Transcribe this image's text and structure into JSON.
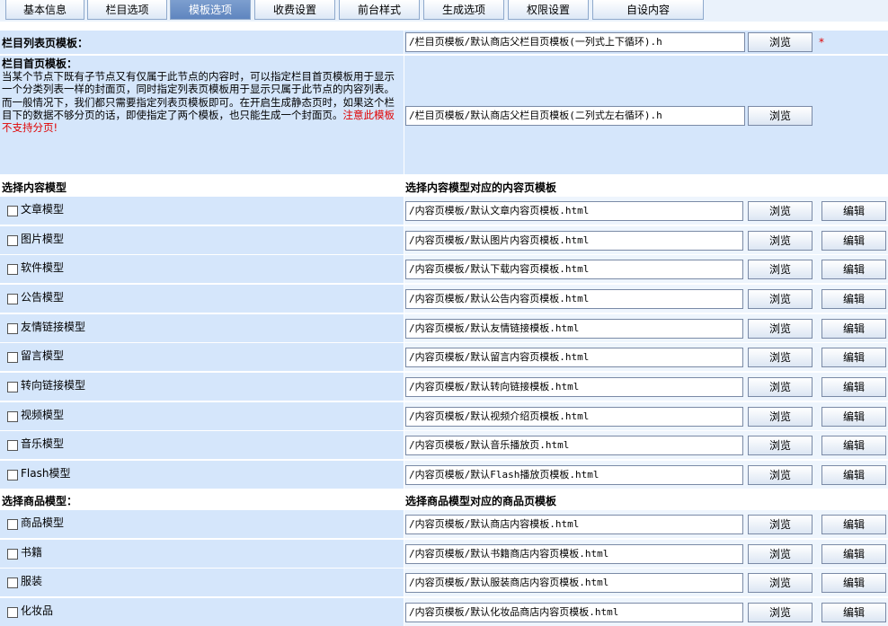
{
  "tabs": [
    "基本信息",
    "栏目选项",
    "模板选项",
    "收费设置",
    "前台样式",
    "生成选项",
    "权限设置",
    "自设内容"
  ],
  "active_tab": 2,
  "list_template": {
    "label": "栏目列表页模板：",
    "value": "/栏目页模板/默认商店父栏目页模板(一列式上下循环).h",
    "browse": "浏览",
    "required": "*"
  },
  "home_template": {
    "label": "栏目首页模板：",
    "description": "当某个节点下既有子节点又有仅属于此节点的内容时，可以指定栏目首页模板用于显示一个分类列表一样的封面页，同时指定列表页模板用于显示只属于此节点的内容列表。而一般情况下，我们都只需要指定列表页模板即可。在开启生成静态页时，如果这个栏目下的数据不够分页的话，即使指定了两个模板，也只能生成一个封面页。",
    "warning": "注意此模板不支持分页!",
    "value": "/栏目页模板/默认商店父栏目页模板(二列式左右循环).h",
    "browse": "浏览"
  },
  "content_section": {
    "left_header": "选择内容模型",
    "right_header": "选择内容模型对应的内容页模板",
    "items": [
      {
        "name": "文章模型",
        "value": "/内容页模板/默认文章内容页模板.html"
      },
      {
        "name": "图片模型",
        "value": "/内容页模板/默认图片内容页模板.html"
      },
      {
        "name": "软件模型",
        "value": "/内容页模板/默认下载内容页模板.html"
      },
      {
        "name": "公告模型",
        "value": "/内容页模板/默认公告内容页模板.html"
      },
      {
        "name": "友情链接模型",
        "value": "/内容页模板/默认友情链接模板.html"
      },
      {
        "name": "留言模型",
        "value": "/内容页模板/默认留言内容页模板.html"
      },
      {
        "name": "转向链接模型",
        "value": "/内容页模板/默认转向链接模板.html"
      },
      {
        "name": "视频模型",
        "value": "/内容页模板/默认视频介绍页模板.html"
      },
      {
        "name": "音乐模型",
        "value": "/内容页模板/默认音乐播放页.html"
      },
      {
        "name": "Flash模型",
        "value": "/内容页模板/默认Flash播放页模板.html"
      }
    ]
  },
  "product_section": {
    "left_header": "选择商品模型：",
    "right_header": "选择商品模型对应的商品页模板",
    "items": [
      {
        "name": "商品模型",
        "value": "/内容页模板/默认商店内容模板.html"
      },
      {
        "name": "书籍",
        "value": "/内容页模板/默认书籍商店内容页模板.html"
      },
      {
        "name": "服装",
        "value": "/内容页模板/默认服装商店内容页模板.html"
      },
      {
        "name": "化妆品",
        "value": "/内容页模板/默认化妆品商店内容页模板.html"
      }
    ]
  },
  "buttons": {
    "browse": "浏览",
    "edit": "编辑"
  }
}
